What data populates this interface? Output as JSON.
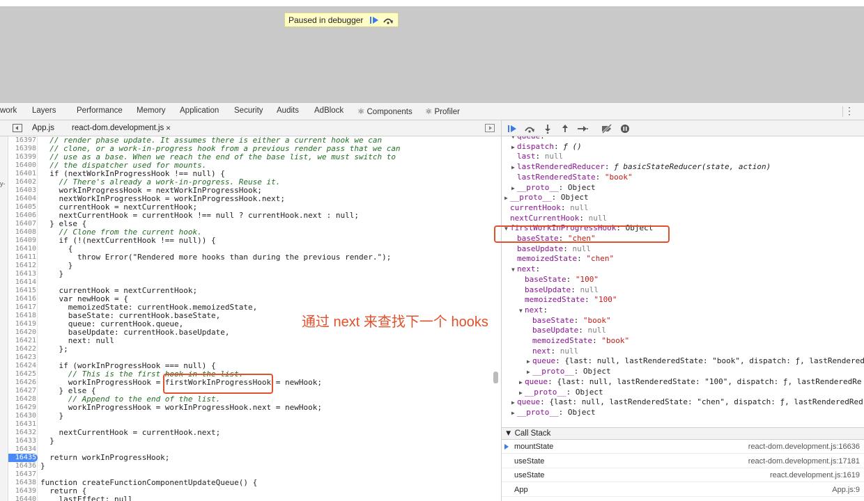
{
  "paused": {
    "label": "Paused in debugger"
  },
  "devtools_tabs": [
    "work",
    "Layers",
    "Performance",
    "Memory",
    "Application",
    "Security",
    "Audits",
    "AdBlock",
    "⚛ Components",
    "⚛ Profiler"
  ],
  "source_tabs": {
    "tab1": "App.js",
    "tab2": "react-dom.development.js",
    "close": "×"
  },
  "left_edge": {
    "text1": "y-"
  },
  "code_lines": [
    {
      "ln": "16397",
      "text": "  // render phase update. It assumes there is either a current hook we can",
      "cls": "comment"
    },
    {
      "ln": "16398",
      "text": "  // clone, or a work-in-progress hook from a previous render pass that we can",
      "cls": "comment"
    },
    {
      "ln": "16399",
      "text": "  // use as a base. When we reach the end of the base list, we must switch to",
      "cls": "comment"
    },
    {
      "ln": "16400",
      "text": "  // the dispatcher used for mounts.",
      "cls": "comment"
    },
    {
      "ln": "16401",
      "text": "  if (nextWorkInProgressHook !== null) {",
      "cls": ""
    },
    {
      "ln": "16402",
      "text": "    // There's already a work-in-progress. Reuse it.",
      "cls": "comment"
    },
    {
      "ln": "16403",
      "text": "    workInProgressHook = nextWorkInProgressHook;",
      "cls": ""
    },
    {
      "ln": "16404",
      "text": "    nextWorkInProgressHook = workInProgressHook.next;",
      "cls": ""
    },
    {
      "ln": "16405",
      "text": "    currentHook = nextCurrentHook;",
      "cls": ""
    },
    {
      "ln": "16406",
      "text": "    nextCurrentHook = currentHook !== null ? currentHook.next : null;",
      "cls": ""
    },
    {
      "ln": "16407",
      "text": "  } else {",
      "cls": ""
    },
    {
      "ln": "16408",
      "text": "    // Clone from the current hook.",
      "cls": "comment"
    },
    {
      "ln": "16409",
      "text": "    if (!(nextCurrentHook !== null)) {",
      "cls": ""
    },
    {
      "ln": "16410",
      "text": "      {",
      "cls": ""
    },
    {
      "ln": "16411",
      "text": "        throw Error(\"Rendered more hooks than during the previous render.\");",
      "cls": ""
    },
    {
      "ln": "16412",
      "text": "      }",
      "cls": ""
    },
    {
      "ln": "16413",
      "text": "    }",
      "cls": ""
    },
    {
      "ln": "16414",
      "text": "",
      "cls": ""
    },
    {
      "ln": "16415",
      "text": "    currentHook = nextCurrentHook;",
      "cls": ""
    },
    {
      "ln": "16416",
      "text": "    var newHook = {",
      "cls": ""
    },
    {
      "ln": "16417",
      "text": "      memoizedState: currentHook.memoizedState,",
      "cls": ""
    },
    {
      "ln": "16418",
      "text": "      baseState: currentHook.baseState,",
      "cls": ""
    },
    {
      "ln": "16419",
      "text": "      queue: currentHook.queue,",
      "cls": ""
    },
    {
      "ln": "16420",
      "text": "      baseUpdate: currentHook.baseUpdate,",
      "cls": ""
    },
    {
      "ln": "16421",
      "text": "      next: null",
      "cls": ""
    },
    {
      "ln": "16422",
      "text": "    };",
      "cls": ""
    },
    {
      "ln": "16423",
      "text": "",
      "cls": ""
    },
    {
      "ln": "16424",
      "text": "    if (workInProgressHook === null) {",
      "cls": ""
    },
    {
      "ln": "16425",
      "text": "      // This is the first hook in the list.",
      "cls": "comment"
    },
    {
      "ln": "16426",
      "text": "      workInProgressHook = firstWorkInProgressHook = newHook;",
      "cls": ""
    },
    {
      "ln": "16427",
      "text": "    } else {",
      "cls": ""
    },
    {
      "ln": "16428",
      "text": "      // Append to the end of the list.",
      "cls": "comment"
    },
    {
      "ln": "16429",
      "text": "      workInProgressHook = workInProgressHook.next = newHook;",
      "cls": ""
    },
    {
      "ln": "16430",
      "text": "    }",
      "cls": ""
    },
    {
      "ln": "16431",
      "text": "",
      "cls": ""
    },
    {
      "ln": "16432",
      "text": "    nextCurrentHook = currentHook.next;",
      "cls": ""
    },
    {
      "ln": "16433",
      "text": "  }",
      "cls": ""
    },
    {
      "ln": "16434",
      "text": "",
      "cls": ""
    },
    {
      "ln": "16435",
      "text": "  return workInProgressHook;",
      "cls": "",
      "active": true
    },
    {
      "ln": "16436",
      "text": "}",
      "cls": ""
    },
    {
      "ln": "16437",
      "text": "",
      "cls": ""
    },
    {
      "ln": "16438",
      "text": "function createFunctionComponentUpdateQueue() {",
      "cls": ""
    },
    {
      "ln": "16439",
      "text": "  return {",
      "cls": ""
    },
    {
      "ln": "16440",
      "text": "    lastEffect: null",
      "cls": ""
    }
  ],
  "scope_lines": [
    {
      "indent": 1,
      "tri": "▼",
      "html_key": "queue",
      "sep": ":",
      "val": "",
      "vcls": ""
    },
    {
      "indent": 1,
      "tri": "▶",
      "html_key": "dispatch",
      "sep": ": ",
      "val": "ƒ ()",
      "vcls": "fn"
    },
    {
      "indent": 1,
      "tri": "",
      "html_key": "last",
      "sep": ": ",
      "val": "null",
      "vcls": "nul"
    },
    {
      "indent": 1,
      "tri": "▶",
      "html_key": "lastRenderedReducer",
      "sep": ": ",
      "val": "ƒ basicStateReducer(state, action)",
      "vcls": "fn"
    },
    {
      "indent": 1,
      "tri": "",
      "html_key": "lastRenderedState",
      "sep": ": ",
      "val": "\"book\"",
      "vcls": "str"
    },
    {
      "indent": 1,
      "tri": "▶",
      "html_key": "__proto__",
      "sep": ": ",
      "val": "Object",
      "vcls": ""
    },
    {
      "indent": 0,
      "tri": "▶",
      "html_key": "__proto__",
      "sep": ": ",
      "val": "Object",
      "vcls": ""
    },
    {
      "indent": 0,
      "tri": "",
      "html_key": "currentHook",
      "sep": ": ",
      "val": "null",
      "vcls": "nul"
    },
    {
      "indent": 0,
      "tri": "",
      "html_key": "nextCurrentHook",
      "sep": ": ",
      "val": "null",
      "vcls": "nul"
    },
    {
      "indent": 0,
      "tri": "▼",
      "html_key": "firstWorkInProgressHook",
      "sep": ": ",
      "val": "Object",
      "vcls": ""
    },
    {
      "indent": 1,
      "tri": "",
      "html_key": "baseState",
      "sep": ": ",
      "val": "\"chen\"",
      "vcls": "str"
    },
    {
      "indent": 1,
      "tri": "",
      "html_key": "baseUpdate",
      "sep": ": ",
      "val": "null",
      "vcls": "nul"
    },
    {
      "indent": 1,
      "tri": "",
      "html_key": "memoizedState",
      "sep": ": ",
      "val": "\"chen\"",
      "vcls": "str"
    },
    {
      "indent": 1,
      "tri": "▼",
      "html_key": "next",
      "sep": ":",
      "val": "",
      "vcls": ""
    },
    {
      "indent": 2,
      "tri": "",
      "html_key": "baseState",
      "sep": ": ",
      "val": "\"100\"",
      "vcls": "str"
    },
    {
      "indent": 2,
      "tri": "",
      "html_key": "baseUpdate",
      "sep": ": ",
      "val": "null",
      "vcls": "nul"
    },
    {
      "indent": 2,
      "tri": "",
      "html_key": "memoizedState",
      "sep": ": ",
      "val": "\"100\"",
      "vcls": "str"
    },
    {
      "indent": 2,
      "tri": "▼",
      "html_key": "next",
      "sep": ":",
      "val": "",
      "vcls": ""
    },
    {
      "indent": 3,
      "tri": "",
      "html_key": "baseState",
      "sep": ": ",
      "val": "\"book\"",
      "vcls": "str"
    },
    {
      "indent": 3,
      "tri": "",
      "html_key": "baseUpdate",
      "sep": ": ",
      "val": "null",
      "vcls": "nul"
    },
    {
      "indent": 3,
      "tri": "",
      "html_key": "memoizedState",
      "sep": ": ",
      "val": "\"book\"",
      "vcls": "str"
    },
    {
      "indent": 3,
      "tri": "",
      "html_key": "next",
      "sep": ": ",
      "val": "null",
      "vcls": "nul"
    },
    {
      "indent": 3,
      "tri": "▶",
      "html_key": "queue",
      "sep": ": ",
      "val": "{last: null, lastRenderedState: \"book\", dispatch: ƒ, lastRendered",
      "vcls": ""
    },
    {
      "indent": 3,
      "tri": "▶",
      "html_key": "__proto__",
      "sep": ": ",
      "val": "Object",
      "vcls": ""
    },
    {
      "indent": 2,
      "tri": "▶",
      "html_key": "queue",
      "sep": ": ",
      "val": "{last: null, lastRenderedState: \"100\", dispatch: ƒ, lastRenderedRe",
      "vcls": ""
    },
    {
      "indent": 2,
      "tri": "▶",
      "html_key": "__proto__",
      "sep": ": ",
      "val": "Object",
      "vcls": ""
    },
    {
      "indent": 1,
      "tri": "▶",
      "html_key": "queue",
      "sep": ": ",
      "val": "{last: null, lastRenderedState: \"chen\", dispatch: ƒ, lastRenderedRed",
      "vcls": ""
    },
    {
      "indent": 1,
      "tri": "▶",
      "html_key": "__proto__",
      "sep": ": ",
      "val": "Object",
      "vcls": ""
    }
  ],
  "call_stack": {
    "header": "▼ Call Stack",
    "frames": [
      {
        "fn": "mountState",
        "loc": "react-dom.development.js:16636",
        "current": true
      },
      {
        "fn": "useState",
        "loc": "react-dom.development.js:17181",
        "current": false
      },
      {
        "fn": "useState",
        "loc": "react.development.js:1619",
        "current": false
      },
      {
        "fn": "App",
        "loc": "App.js:9",
        "current": false
      }
    ]
  },
  "annotation": {
    "text": "通过 next 来查找下一个 hooks"
  },
  "colors": {
    "accent": "#4a8af4",
    "annotation": "#e2502b"
  }
}
